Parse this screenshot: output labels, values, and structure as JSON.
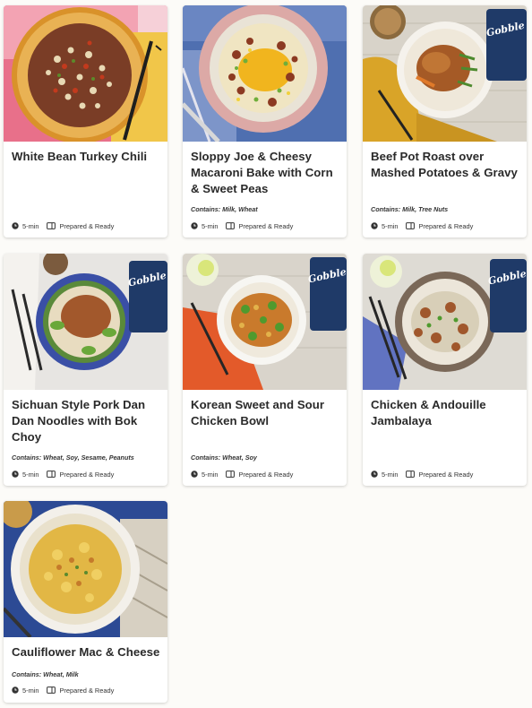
{
  "cards": [
    {
      "title": "White Bean Turkey Chili",
      "contains": "",
      "time": "5-min",
      "prep": "Prepared & Ready"
    },
    {
      "title": "Sloppy Joe & Cheesy Macaroni Bake with Corn & Sweet Peas",
      "contains": "Contains: Milk, Wheat",
      "time": "5-min",
      "prep": "Prepared & Ready"
    },
    {
      "title": "Beef Pot Roast over Mashed Potatoes & Gravy",
      "contains": "Contains: Milk, Tree Nuts",
      "time": "5-min",
      "prep": "Prepared & Ready"
    },
    {
      "title": "Sichuan Style Pork Dan Dan Noodles with Bok Choy",
      "contains": "Contains: Wheat, Soy, Sesame, Peanuts",
      "time": "5-min",
      "prep": "Prepared & Ready"
    },
    {
      "title": "Korean Sweet and Sour Chicken Bowl",
      "contains": "Contains: Wheat, Soy",
      "time": "5-min",
      "prep": "Prepared & Ready"
    },
    {
      "title": "Chicken & Andouille Jambalaya",
      "contains": "",
      "time": "5-min",
      "prep": "Prepared & Ready"
    },
    {
      "title": "Cauliflower Mac & Cheese",
      "contains": "Contains: Wheat, Milk",
      "time": "5-min",
      "prep": "Prepared & Ready"
    }
  ],
  "brand": "Gobble",
  "icons": {
    "time": "clock-icon",
    "prep": "meal-tray-icon"
  }
}
